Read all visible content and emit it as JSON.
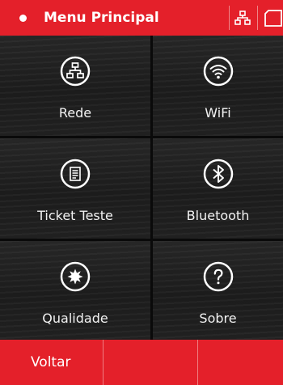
{
  "header": {
    "title": "Menu Principal"
  },
  "menu": {
    "items": [
      {
        "label": "Rede",
        "icon": "network-icon"
      },
      {
        "label": "WiFi",
        "icon": "wifi-icon"
      },
      {
        "label": "Ticket Teste",
        "icon": "ticket-icon"
      },
      {
        "label": "Bluetooth",
        "icon": "bluetooth-icon"
      },
      {
        "label": "Qualidade",
        "icon": "quality-icon"
      },
      {
        "label": "Sobre",
        "icon": "help-icon"
      }
    ]
  },
  "footer": {
    "back_label": "Voltar"
  },
  "colors": {
    "accent": "#e4202a",
    "tile": "#222222",
    "text": "#f2f2f2"
  }
}
